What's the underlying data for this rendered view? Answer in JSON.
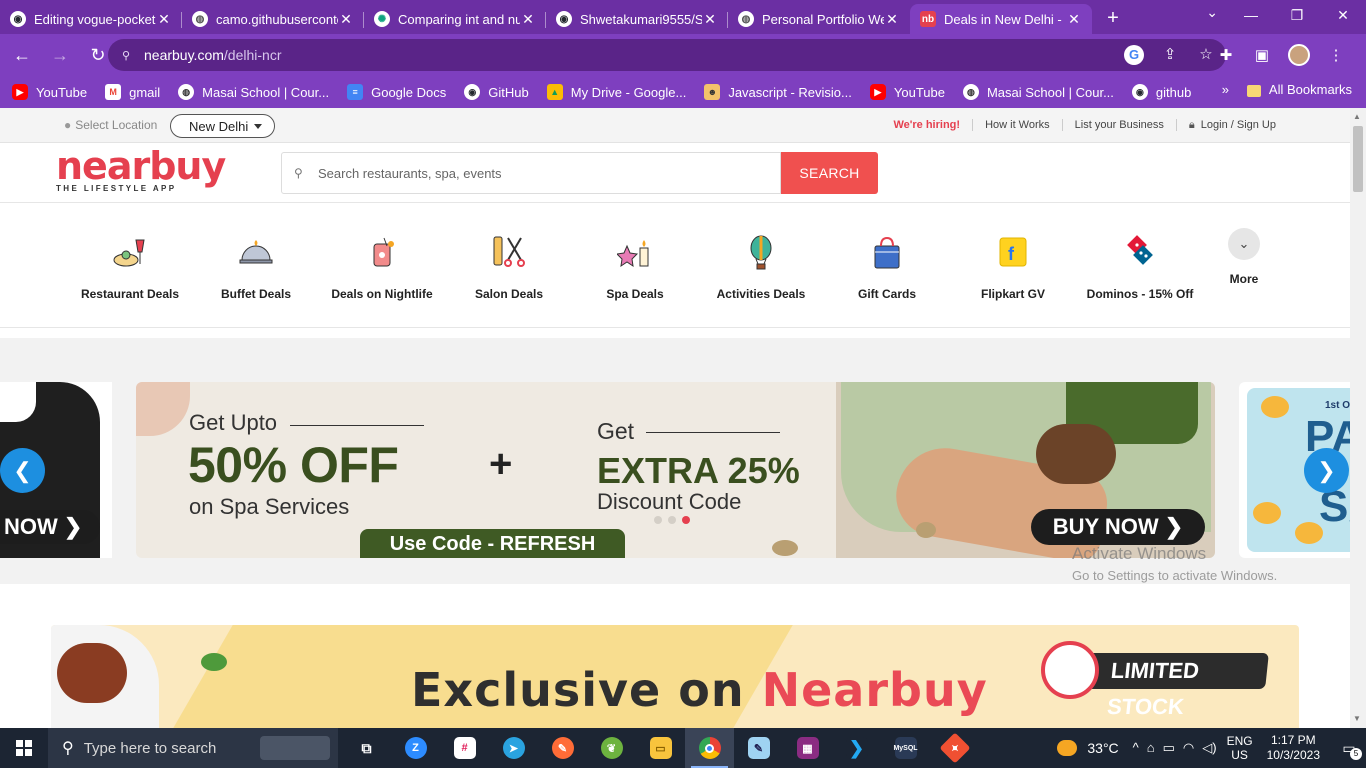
{
  "browser": {
    "tabs": [
      {
        "label": "Editing vogue-pocket",
        "favicon": "github-icon",
        "active": false
      },
      {
        "label": "camo.githubuserconte",
        "favicon": "globe-icon",
        "active": false
      },
      {
        "label": "Comparing int and nu",
        "favicon": "chatgpt-icon",
        "active": false
      },
      {
        "label": "Shwetakumari9555/Sh",
        "favicon": "github-icon",
        "active": false
      },
      {
        "label": "Personal Portfolio We",
        "favicon": "globe-icon",
        "active": false
      },
      {
        "label": "Deals in New Delhi -",
        "favicon": "nearbuy-icon",
        "active": true
      }
    ],
    "url_host": "nearbuy.com",
    "url_path": "/delhi-ncr",
    "bookmarks": [
      {
        "label": "YouTube",
        "icon": "youtube-icon"
      },
      {
        "label": "gmail",
        "icon": "gmail-icon"
      },
      {
        "label": "Masai School | Cour...",
        "icon": "masai-icon"
      },
      {
        "label": "Google Docs",
        "icon": "docs-icon"
      },
      {
        "label": "GitHub",
        "icon": "github-icon"
      },
      {
        "label": "My Drive - Google...",
        "icon": "drive-icon"
      },
      {
        "label": "Javascript - Revisio...",
        "icon": "js-icon"
      },
      {
        "label": "YouTube",
        "icon": "youtube-icon"
      },
      {
        "label": "Masai School | Cour...",
        "icon": "masai-icon"
      },
      {
        "label": "github",
        "icon": "github-icon"
      }
    ],
    "all_bookmarks": "All Bookmarks",
    "colors": {
      "frame": "#6b2fa3",
      "toolbar": "#7e3fbf"
    }
  },
  "site": {
    "select_location": "Select Location",
    "city": "New Delhi",
    "top_links": {
      "hiring": "We're hiring!",
      "how": "How it Works",
      "list": "List your Business",
      "login": "Login / Sign Up"
    },
    "logo_word": "nearbuy",
    "logo_tag": "THE LIFESTYLE APP",
    "search_placeholder": "Search restaurants, spa, events",
    "search_button": "SEARCH",
    "categories": [
      {
        "label": "Restaurant Deals",
        "icon": "restaurant-icon"
      },
      {
        "label": "Buffet Deals",
        "icon": "buffet-cloche-icon"
      },
      {
        "label": "Deals on Nightlife",
        "icon": "nightlife-drink-icon"
      },
      {
        "label": "Salon Deals",
        "icon": "salon-scissors-icon"
      },
      {
        "label": "Spa Deals",
        "icon": "spa-candle-icon"
      },
      {
        "label": "Activities Deals",
        "icon": "hot-air-balloon-icon"
      },
      {
        "label": "Gift Cards",
        "icon": "gift-bag-icon"
      },
      {
        "label": "Flipkart GV",
        "icon": "flipkart-icon"
      },
      {
        "label": "Dominos - 15% Off",
        "icon": "dominos-icon"
      }
    ],
    "more_label": "More",
    "banner": {
      "left_cta": "NOW",
      "get_upto": "Get Upto",
      "off": "50% OFF",
      "on_spa": "on Spa Services",
      "plus": "+",
      "get": "Get",
      "extra": "EXTRA 25%",
      "discount_code": "Discount Code",
      "use_code": "Use Code - REFRESH",
      "buy_now": "BUY NOW",
      "active_dot": 2,
      "right_small": "1st O",
      "right_big1": "PAY",
      "right_big2": "SA"
    },
    "promo": {
      "exclusive_on": "Exclusive on ",
      "brand": "Nearbuy",
      "limited": "LIMITED STOCK"
    },
    "watermark": {
      "line1": "Activate Windows",
      "line2": "Go to Settings to activate Windows."
    },
    "brand_color": "#e5404f"
  },
  "taskbar": {
    "search_placeholder": "Type here to search",
    "apps": [
      "task-view-icon",
      "zoom-icon",
      "slack-icon",
      "telegram-icon",
      "postman-icon",
      "spring-icon",
      "file-explorer-icon",
      "chrome-icon",
      "notepad-icon",
      "winrar-icon",
      "vscode-icon",
      "mysql-icon",
      "git-icon"
    ],
    "temperature": "33°C",
    "lang1": "ENG",
    "lang2": "US",
    "time": "1:17 PM",
    "date": "10/3/2023",
    "notifications": "5"
  }
}
